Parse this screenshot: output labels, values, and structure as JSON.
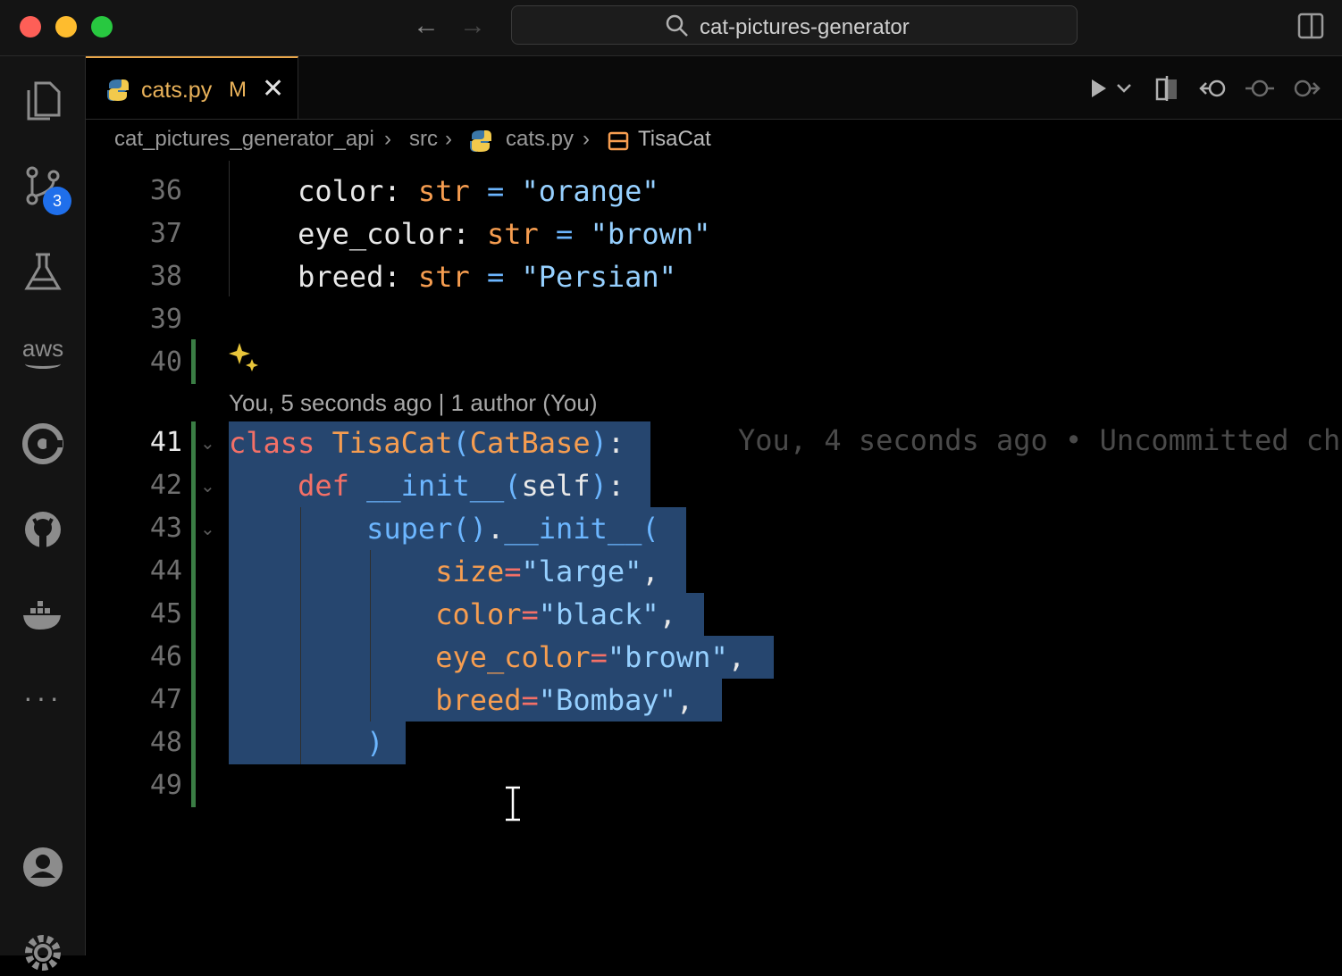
{
  "window": {
    "title": "cat-pictures-generator",
    "colors": {
      "close": "#fe5f57",
      "minimize": "#febc2e",
      "zoom": "#28c840"
    }
  },
  "activity_bar": {
    "items": [
      {
        "name": "explorer-icon"
      },
      {
        "name": "source-control-icon",
        "badge": "3"
      },
      {
        "name": "testing-icon"
      },
      {
        "name": "aws-icon",
        "label": "aws"
      },
      {
        "name": "remote-icon"
      },
      {
        "name": "github-icon"
      },
      {
        "name": "docker-icon"
      },
      {
        "name": "more-icon"
      },
      {
        "name": "account-icon"
      },
      {
        "name": "settings-icon"
      }
    ]
  },
  "tab": {
    "label": "cats.py",
    "status": "M"
  },
  "breadcrumb": {
    "parts": [
      "cat_pictures_generator_api",
      "src",
      "cats.py",
      "TisaCat"
    ]
  },
  "editor": {
    "line_numbers": [
      "36",
      "37",
      "38",
      "39",
      "40",
      "41",
      "42",
      "43",
      "44",
      "45",
      "46",
      "47",
      "48",
      "49"
    ],
    "active_line": "41",
    "blame_header": "You, 5 seconds ago | 1 author (You)",
    "inline_blame": "You, 4 seconds ago • Uncommitted ch",
    "code": {
      "l36_name": "color",
      "l36_type": "str",
      "l36_val": "\"orange\"",
      "l37_name": "eye_color",
      "l37_type": "str",
      "l37_val": "\"brown\"",
      "l38_name": "breed",
      "l38_type": "str",
      "l38_val": "\"Persian\"",
      "l41_kw": "class",
      "l41_cls": "TisaCat",
      "l41_base": "CatBase",
      "l42_kw": "def",
      "l42_fn": "__init__",
      "l42_arg": "self",
      "l43_fn": "super",
      "l43_init": "__init__",
      "l44_k": "size",
      "l44_v": "\"large\"",
      "l45_k": "color",
      "l45_v": "\"black\"",
      "l46_k": "eye_color",
      "l46_v": "\"brown\"",
      "l47_k": "breed",
      "l47_v": "\"Bombay\"",
      "l48": ")"
    }
  }
}
